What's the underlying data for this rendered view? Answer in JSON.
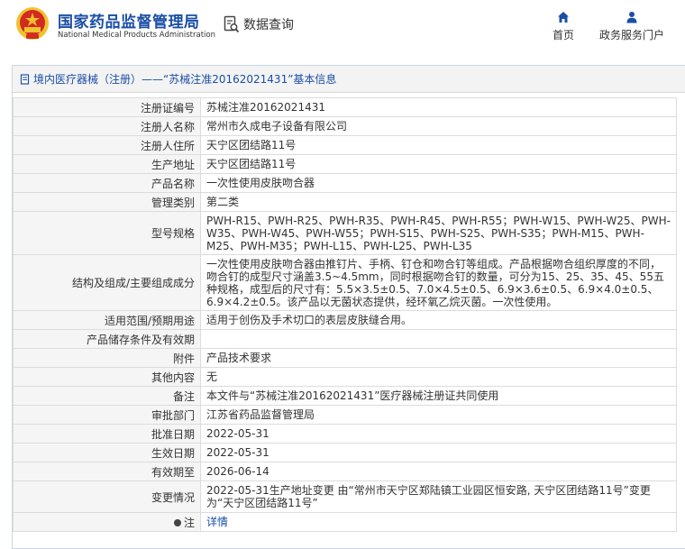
{
  "header": {
    "brand_cn": "国家药品监督管理局",
    "brand_en": "National Medical Products Administration",
    "query_label": "数据查询",
    "nav": {
      "home": "首页",
      "portal": "政务服务门户"
    },
    "colors": {
      "brand": "#1a4ea6",
      "emblem": "#d22b1f",
      "gold": "#f2c230"
    }
  },
  "breadcrumb": "境内医疗器械（注册）——“苏械注准20162021431”基本信息",
  "rows": [
    {
      "key": "注册证编号",
      "value": "苏械注准20162021431"
    },
    {
      "key": "注册人名称",
      "value": "常州市久成电子设备有限公司"
    },
    {
      "key": "注册人住所",
      "value": "天宁区团结路11号"
    },
    {
      "key": "生产地址",
      "value": "天宁区团结路11号"
    },
    {
      "key": "产品名称",
      "value": "一次性使用皮肤吻合器"
    },
    {
      "key": "管理类别",
      "value": "第二类"
    },
    {
      "key": "型号规格",
      "value": "PWH-R15、PWH-R25、PWH-R35、PWH-R45、PWH-R55；PWH-W15、PWH-W25、PWH-W35、PWH-W45、PWH-W55；PWH-S15、PWH-S25、PWH-S35；PWH-M15、PWH-M25、PWH-M35；PWH-L15、PWH-L25、PWH-L35"
    },
    {
      "key": "结构及组成/主要组成成分",
      "value": "一次性使用皮肤吻合器由推钉片、手柄、钉仓和吻合钉等组成。产品根据吻合组织厚度的不同，吻合钉的成型尺寸涵盖3.5~4.5mm，同时根据吻合钉的数量，可分为15、25、35、45、55五种规格，成型后的尺寸有：5.5×3.5±0.5、7.0×4.5±0.5、6.9×3.6±0.5、6.9×4.0±0.5、6.9×4.2±0.5。该产品以无菌状态提供，经环氧乙烷灭菌。一次性使用。"
    },
    {
      "key": "适用范围/预期用途",
      "value": "适用于创伤及手术切口的表层皮肤缝合用。"
    },
    {
      "key": "产品储存条件及有效期",
      "value": ""
    },
    {
      "key": "附件",
      "value": "产品技术要求"
    },
    {
      "key": "其他内容",
      "value": "无"
    },
    {
      "key": "备注",
      "value": "本文件与“苏械注准20162021431”医疗器械注册证共同使用"
    },
    {
      "key": "审批部门",
      "value": "江苏省药品监督管理局"
    },
    {
      "key": "批准日期",
      "value": "2022-05-31"
    },
    {
      "key": "生效日期",
      "value": "2022-05-31"
    },
    {
      "key": "有效期至",
      "value": "2026-06-14"
    },
    {
      "key": "变更情况",
      "value": "2022-05-31生产地址变更 由“常州市天宁区郑陆镇工业园区恒安路, 天宁区团结路11号”变更为“天宁区团结路11号”"
    },
    {
      "key": "注",
      "value": "详情"
    }
  ]
}
